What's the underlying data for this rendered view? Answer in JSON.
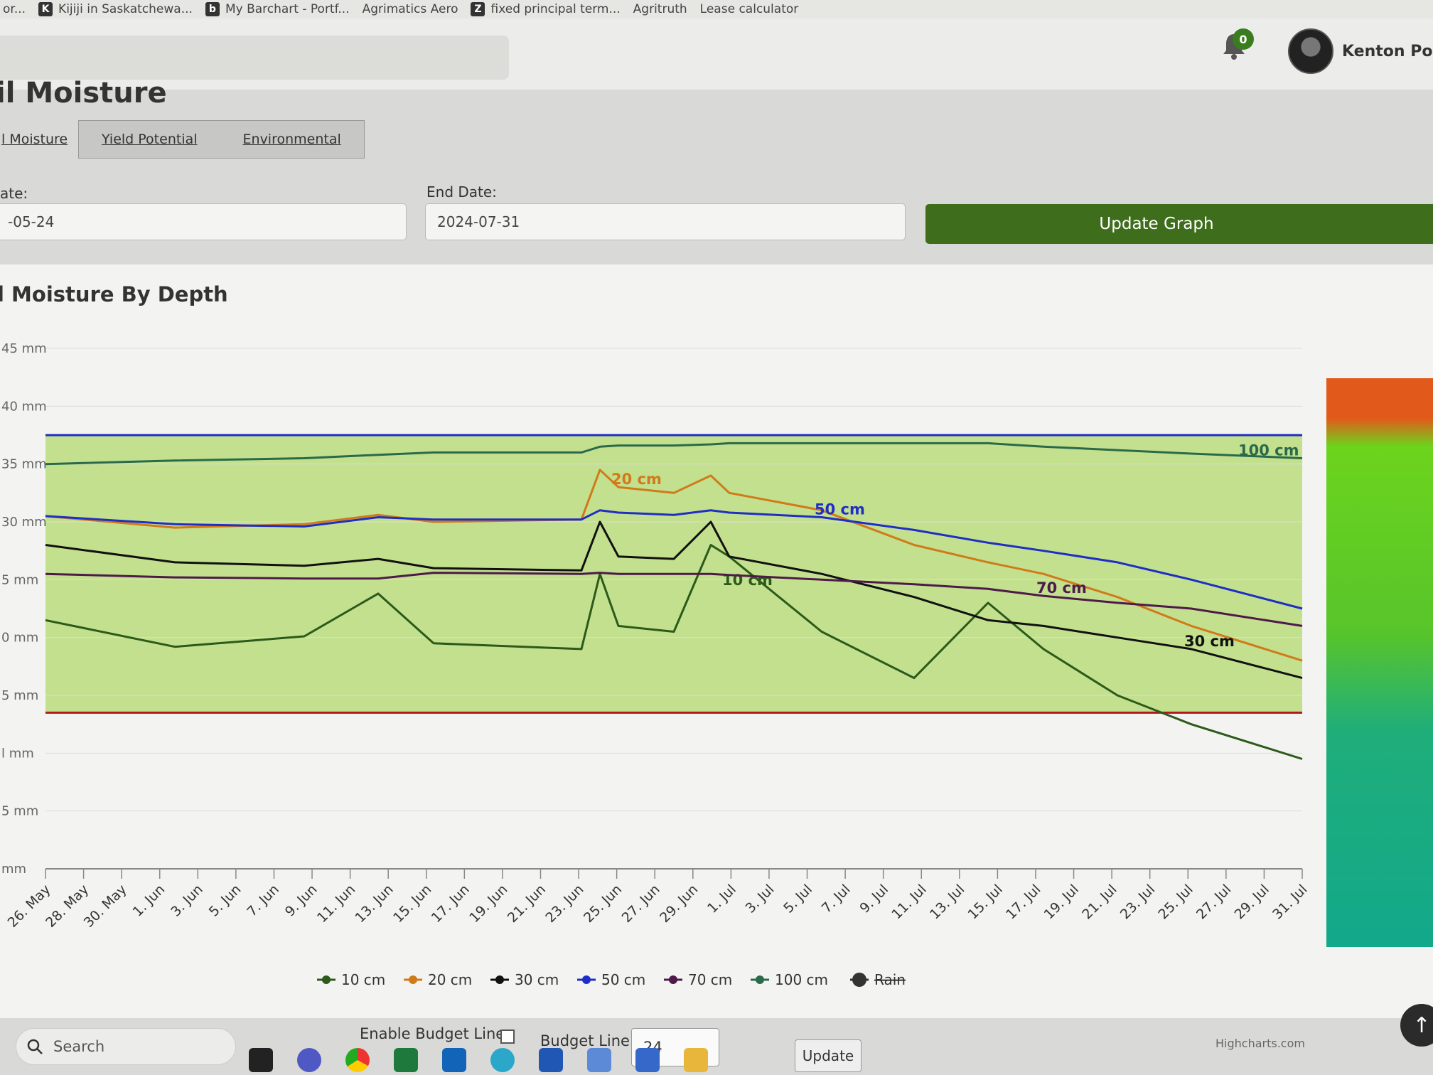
{
  "browser": {
    "bookmarks": [
      {
        "label": "or...",
        "icon": ""
      },
      {
        "label": "Kijiji in Saskatchewa...",
        "icon": "K"
      },
      {
        "label": "My Barchart - Portf...",
        "icon": "b"
      },
      {
        "label": "Agrimatics Aero",
        "icon": ""
      },
      {
        "label": "fixed principal term...",
        "icon": "Z"
      },
      {
        "label": "Agritruth",
        "icon": ""
      },
      {
        "label": "Lease calculator",
        "icon": ""
      }
    ]
  },
  "header": {
    "notification_count": "0",
    "user_name": "Kenton Poss"
  },
  "page": {
    "title": "il Moisture",
    "tabs": {
      "active": "l Moisture",
      "others": [
        "Yield Potential",
        "Environmental"
      ]
    },
    "start_date_label": "ate:",
    "start_date_value": "-05-24",
    "end_date_label": "End Date:",
    "end_date_value": "2024-07-31",
    "update_button": "Update Graph"
  },
  "chart_data": {
    "type": "line",
    "title": "l Moisture By Depth",
    "y_ticks": [
      "45 mm",
      "40 mm",
      "35 mm",
      "30 mm",
      "5 mm",
      "0 mm",
      "5 mm",
      "l mm",
      "5 mm",
      "mm"
    ],
    "x_ticks": [
      "26. May",
      "28. May",
      "30. May",
      "1. Jun",
      "3. Jun",
      "5. Jun",
      "7. Jun",
      "9. Jun",
      "11. Jun",
      "13. Jun",
      "15. Jun",
      "17. Jun",
      "19. Jun",
      "21. Jun",
      "23. Jun",
      "25. Jun",
      "27. Jun",
      "29. Jun",
      "1. Jul",
      "3. Jul",
      "5. Jul",
      "7. Jul",
      "9. Jul",
      "11. Jul",
      "13. Jul",
      "15. Jul",
      "17. Jul",
      "19. Jul",
      "21. Jul",
      "23. Jul",
      "25. Jul",
      "27. Jul",
      "29. Jul",
      "31. Jul"
    ],
    "x_dates": [
      "2024-05-24",
      "2024-05-31",
      "2024-06-07",
      "2024-06-11",
      "2024-06-14",
      "2024-06-22",
      "2024-06-23",
      "2024-06-24",
      "2024-06-27",
      "2024-06-29",
      "2024-06-30",
      "2024-07-05",
      "2024-07-10",
      "2024-07-14",
      "2024-07-17",
      "2024-07-21",
      "2024-07-25",
      "2024-07-31"
    ],
    "series": [
      {
        "name": "10 cm",
        "color": "#2b5a1a",
        "label": "10 cm",
        "values": [
          21.5,
          19.2,
          20.1,
          23.8,
          19.5,
          19.0,
          25.5,
          21.0,
          20.5,
          28.0,
          27.0,
          20.5,
          16.5,
          23.0,
          19.0,
          15.0,
          12.5,
          9.5
        ]
      },
      {
        "name": "20 cm",
        "color": "#d07a1a",
        "label": "20 cm",
        "values": [
          30.5,
          29.5,
          29.8,
          30.6,
          30.0,
          30.2,
          34.5,
          33.0,
          32.5,
          34.0,
          32.5,
          31.0,
          28.0,
          26.5,
          25.5,
          23.5,
          21.0,
          18.0
        ]
      },
      {
        "name": "30 cm",
        "color": "#111111",
        "label": "30 cm",
        "values": [
          28.0,
          26.5,
          26.2,
          26.8,
          26.0,
          25.8,
          30.0,
          27.0,
          26.8,
          30.0,
          27.0,
          25.5,
          23.5,
          21.5,
          21.0,
          20.0,
          19.0,
          16.5
        ]
      },
      {
        "name": "50 cm",
        "color": "#1f2ec4",
        "label": "50 cm",
        "values": [
          30.5,
          29.8,
          29.6,
          30.4,
          30.2,
          30.2,
          31.0,
          30.8,
          30.6,
          31.0,
          30.8,
          30.4,
          29.3,
          28.2,
          27.5,
          26.5,
          25.0,
          22.5
        ]
      },
      {
        "name": "70 cm",
        "color": "#4d1a4a",
        "label": "70 cm",
        "values": [
          25.5,
          25.2,
          25.1,
          25.1,
          25.6,
          25.5,
          25.6,
          25.5,
          25.5,
          25.5,
          25.4,
          25.0,
          24.6,
          24.2,
          23.6,
          23.0,
          22.5,
          21.0
        ]
      },
      {
        "name": "100 cm",
        "color": "#2a6a4a",
        "label": "100 cm",
        "values": [
          35.0,
          35.3,
          35.5,
          35.8,
          36.0,
          36.0,
          36.5,
          36.6,
          36.6,
          36.7,
          36.8,
          36.8,
          36.8,
          36.8,
          36.5,
          36.2,
          35.9,
          35.5
        ]
      },
      {
        "name": "Rain",
        "color": "#333333",
        "label": "",
        "values": []
      }
    ],
    "upper_line": 37.5,
    "lower_line": 13.5,
    "legend_position": "bottom"
  },
  "bottom": {
    "budget_checkbox_label": "Enable Budget Line:",
    "budget_line_label": "Budget Line:",
    "budget_line_value": "24",
    "update_label": "Update",
    "credits": "Highcharts.com"
  },
  "taskbar": {
    "search_placeholder": "Search"
  }
}
